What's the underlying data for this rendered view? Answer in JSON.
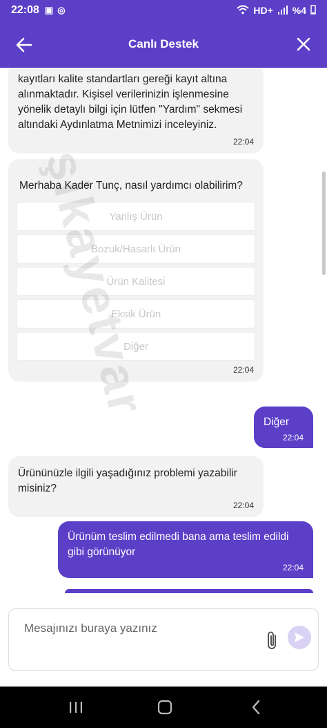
{
  "status_bar": {
    "time": "22:08",
    "network": "HD+",
    "battery": "%4"
  },
  "header": {
    "title": "Canlı Destek"
  },
  "messages": {
    "privacy": {
      "text": "kayıtları kalite standartları gereği kayıt altına alınmaktadır. Kişisel verilerinizin işlenmesine yönelik detaylı bilgi için lütfen \"Yardım\" sekmesi altındaki Aydınlatma Metnimizi inceleyiniz.",
      "time": "22:04"
    },
    "greeting": {
      "text": "Merhaba Kader Tunç, nasıl yardımcı olabilirim?",
      "time": "22:04",
      "options": [
        "Yanlış Ürün",
        "Bozuk/Hasarlı Ürün",
        "Ürün Kalitesi",
        "Eksik Ürün",
        "Diğer"
      ]
    },
    "user_choice": {
      "text": "Diğer",
      "time": "22:04"
    },
    "question": {
      "text": "Ürününüzle ilgili yaşadığınız problemi yazabilir misiniz?",
      "time": "22:04"
    },
    "user_reply": {
      "text": "Ürünüm teslim edilmedi bana ama teslim edildi gibi görünüyor",
      "time": "22:04"
    }
  },
  "watermark": "şikayetvar",
  "composer": {
    "placeholder": "Mesajınızı buraya yazınız"
  },
  "icons": {
    "back": "arrow-left-icon",
    "close": "close-icon",
    "attach": "paperclip-icon",
    "send": "send-icon",
    "nav": [
      "recent-apps-icon",
      "home-icon",
      "back-nav-icon"
    ]
  },
  "colors": {
    "primary": "#5b3fc7",
    "bubble_in": "#f2f2f2",
    "send_disabled": "#d9d2f5"
  }
}
